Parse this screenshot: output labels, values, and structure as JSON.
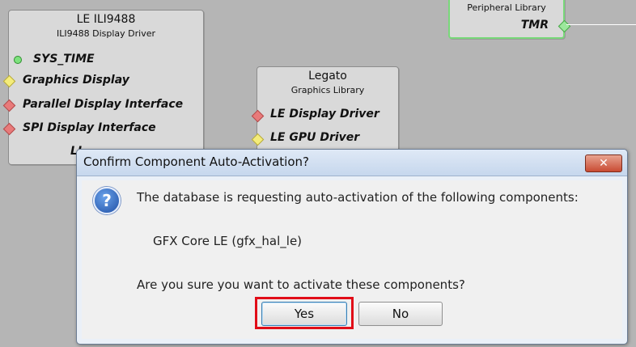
{
  "canvas": {
    "nodes": {
      "ili9488": {
        "title": "LE ILI9488",
        "subtitle": "ILI9488 Display Driver",
        "ports": [
          {
            "label": "SYS_TIME",
            "kind": "circle-green"
          },
          {
            "label": "Graphics Display",
            "kind": "diamond-yellow"
          },
          {
            "label": "Parallel Display Interface",
            "kind": "diamond-red"
          },
          {
            "label": "SPI Display Interface",
            "kind": "diamond-red"
          }
        ],
        "partial_label": "LI"
      },
      "legato": {
        "title": "Legato",
        "subtitle": "Graphics Library",
        "ports": [
          {
            "label": "LE Display Driver",
            "kind": "diamond-red"
          },
          {
            "label": "LE GPU Driver",
            "kind": "diamond-yellow"
          }
        ]
      },
      "tmr": {
        "subtitle": "Peripheral Library",
        "port_label": "TMR"
      }
    }
  },
  "dialog": {
    "title": "Confirm Component Auto-Activation?",
    "close_label": "✕",
    "icon": "question-icon",
    "message": "The database is requesting auto-activation of the following components:",
    "component": "GFX Core LE (gfx_hal_le)",
    "question": "Are you sure you want to activate these components?",
    "yes_label": "Yes",
    "no_label": "No"
  },
  "colors": {
    "highlight": "#e10d18",
    "tmr_border": "#79d87a"
  }
}
